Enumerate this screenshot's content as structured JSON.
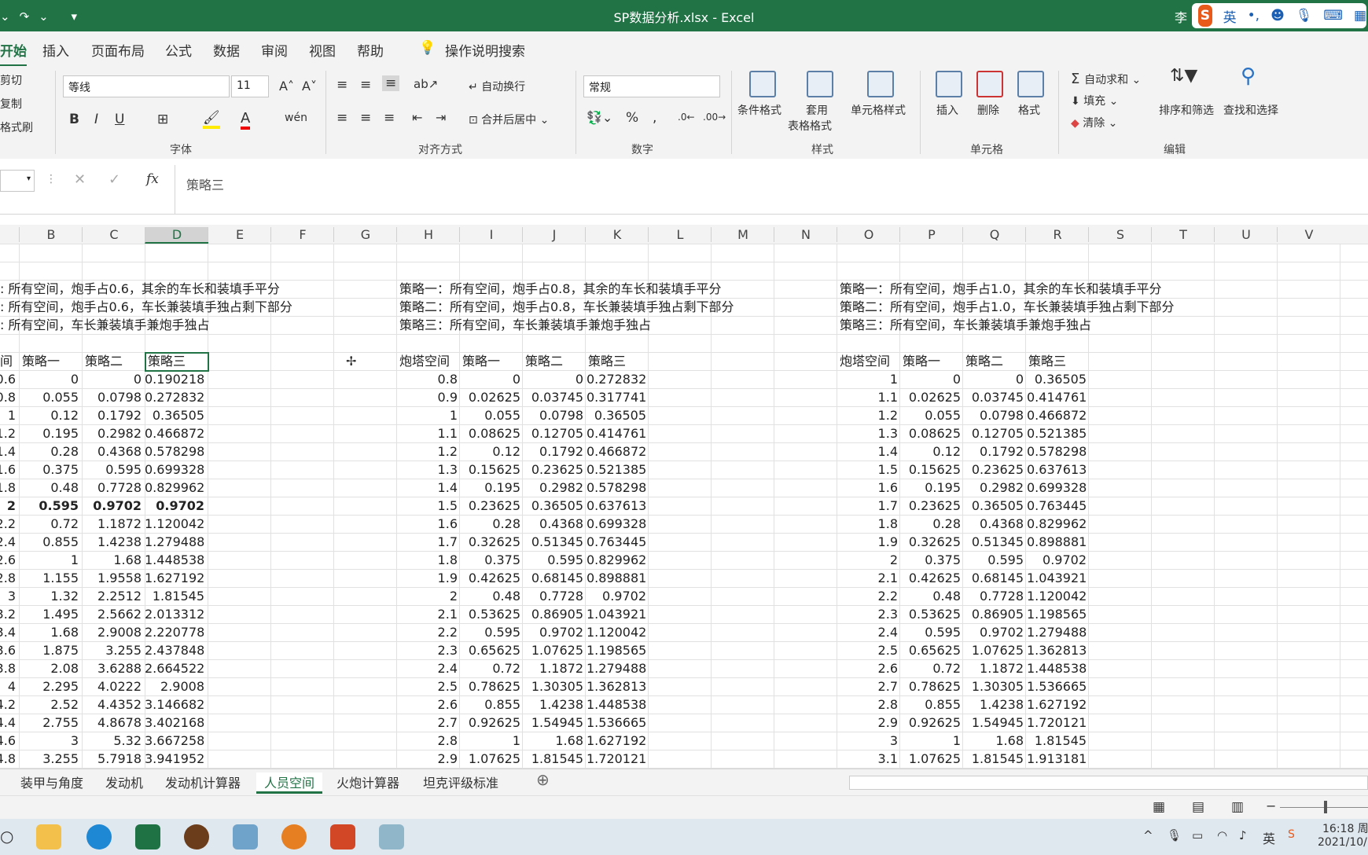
{
  "window": {
    "title": "SP数据分析.xlsx - Excel",
    "user": "李"
  },
  "ime": {
    "logo": "S",
    "mode": "英"
  },
  "menu": [
    "开始",
    "插入",
    "页面布局",
    "公式",
    "数据",
    "审阅",
    "视图",
    "帮助",
    "操作说明搜索"
  ],
  "ribbon": {
    "clipboard": [
      "剪切",
      "复制",
      "格式刷"
    ],
    "font_name": "等线",
    "font_size": "11",
    "font_group": "字体",
    "wrap": "自动换行",
    "merge": "合并后居中",
    "align_group": "对齐方式",
    "number_format": "常规",
    "number_group": "数字",
    "cond_format": "条件格式",
    "table_format_1": "套用",
    "table_format_2": "表格格式",
    "cell_style": "单元格样式",
    "style_group": "样式",
    "insert": "插入",
    "delete": "删除",
    "format": "格式",
    "cells_group": "单元格",
    "autosum": "自动求和",
    "fill": "填充",
    "clear": "清除",
    "sort": "排序和筛选",
    "find": "查找和选择",
    "edit_group": "编辑"
  },
  "formula_bar": {
    "content": "策略三",
    "fx": "fx"
  },
  "columns": [
    "B",
    "C",
    "D",
    "E",
    "F",
    "G",
    "H",
    "I",
    "J",
    "K",
    "L",
    "M",
    "N",
    "O",
    "P",
    "Q",
    "R",
    "S",
    "T",
    "U",
    "V"
  ],
  "blocks": [
    {
      "notes": [
        ":  所有空间，炮手占0.6，其余的车长和装填手平分",
        ":  所有空间，炮手占0.6，车长兼装填手独占剩下部分",
        ":  所有空间，车长兼装填手兼炮手独占"
      ],
      "headers": [
        "间",
        "策略一",
        "策略二",
        "策略三"
      ],
      "rows": [
        [
          "0.6",
          "0",
          "0",
          "0.190218"
        ],
        [
          "0.8",
          "0.055",
          "0.0798",
          "0.272832"
        ],
        [
          "1",
          "0.12",
          "0.1792",
          "0.36505"
        ],
        [
          "1.2",
          "0.195",
          "0.2982",
          "0.466872"
        ],
        [
          "1.4",
          "0.28",
          "0.4368",
          "0.578298"
        ],
        [
          "1.6",
          "0.375",
          "0.595",
          "0.699328"
        ],
        [
          "1.8",
          "0.48",
          "0.7728",
          "0.829962"
        ],
        [
          "2",
          "0.595",
          "0.9702",
          "0.9702"
        ],
        [
          "2.2",
          "0.72",
          "1.1872",
          "1.120042"
        ],
        [
          "2.4",
          "0.855",
          "1.4238",
          "1.279488"
        ],
        [
          "2.6",
          "1",
          "1.68",
          "1.448538"
        ],
        [
          "2.8",
          "1.155",
          "1.9558",
          "1.627192"
        ],
        [
          "3",
          "1.32",
          "2.2512",
          "1.81545"
        ],
        [
          "3.2",
          "1.495",
          "2.5662",
          "2.013312"
        ],
        [
          "3.4",
          "1.68",
          "2.9008",
          "2.220778"
        ],
        [
          "3.6",
          "1.875",
          "3.255",
          "2.437848"
        ],
        [
          "3.8",
          "2.08",
          "3.6288",
          "2.664522"
        ],
        [
          "4",
          "2.295",
          "4.0222",
          "2.9008"
        ],
        [
          "4.2",
          "2.52",
          "4.4352",
          "3.146682"
        ],
        [
          "4.4",
          "2.755",
          "4.8678",
          "3.402168"
        ],
        [
          "4.6",
          "3",
          "5.32",
          "3.667258"
        ],
        [
          "4.8",
          "3.255",
          "5.7918",
          "3.941952"
        ]
      ]
    },
    {
      "notes": [
        "策略一：所有空间，炮手占0.8，其余的车长和装填手平分",
        "策略二：所有空间，炮手占0.8，车长兼装填手独占剩下部分",
        "策略三：所有空间，车长兼装填手兼炮手独占"
      ],
      "headers": [
        "炮塔空间",
        "策略一",
        "策略二",
        "策略三"
      ],
      "rows": [
        [
          "0.8",
          "0",
          "0",
          "0.272832"
        ],
        [
          "0.9",
          "0.02625",
          "0.03745",
          "0.317741"
        ],
        [
          "1",
          "0.055",
          "0.0798",
          "0.36505"
        ],
        [
          "1.1",
          "0.08625",
          "0.12705",
          "0.414761"
        ],
        [
          "1.2",
          "0.12",
          "0.1792",
          "0.466872"
        ],
        [
          "1.3",
          "0.15625",
          "0.23625",
          "0.521385"
        ],
        [
          "1.4",
          "0.195",
          "0.2982",
          "0.578298"
        ],
        [
          "1.5",
          "0.23625",
          "0.36505",
          "0.637613"
        ],
        [
          "1.6",
          "0.28",
          "0.4368",
          "0.699328"
        ],
        [
          "1.7",
          "0.32625",
          "0.51345",
          "0.763445"
        ],
        [
          "1.8",
          "0.375",
          "0.595",
          "0.829962"
        ],
        [
          "1.9",
          "0.42625",
          "0.68145",
          "0.898881"
        ],
        [
          "2",
          "0.48",
          "0.7728",
          "0.9702"
        ],
        [
          "2.1",
          "0.53625",
          "0.86905",
          "1.043921"
        ],
        [
          "2.2",
          "0.595",
          "0.9702",
          "1.120042"
        ],
        [
          "2.3",
          "0.65625",
          "1.07625",
          "1.198565"
        ],
        [
          "2.4",
          "0.72",
          "1.1872",
          "1.279488"
        ],
        [
          "2.5",
          "0.78625",
          "1.30305",
          "1.362813"
        ],
        [
          "2.6",
          "0.855",
          "1.4238",
          "1.448538"
        ],
        [
          "2.7",
          "0.92625",
          "1.54945",
          "1.536665"
        ],
        [
          "2.8",
          "1",
          "1.68",
          "1.627192"
        ],
        [
          "2.9",
          "1.07625",
          "1.81545",
          "1.720121"
        ]
      ]
    },
    {
      "notes": [
        "策略一：所有空间，炮手占1.0，其余的车长和装填手平分",
        "策略二：所有空间，炮手占1.0，车长兼装填手独占剩下部分",
        "策略三：所有空间，车长兼装填手兼炮手独占"
      ],
      "headers": [
        "炮塔空间",
        "策略一",
        "策略二",
        "策略三"
      ],
      "rows": [
        [
          "1",
          "0",
          "0",
          "0.36505"
        ],
        [
          "1.1",
          "0.02625",
          "0.03745",
          "0.414761"
        ],
        [
          "1.2",
          "0.055",
          "0.0798",
          "0.466872"
        ],
        [
          "1.3",
          "0.08625",
          "0.12705",
          "0.521385"
        ],
        [
          "1.4",
          "0.12",
          "0.1792",
          "0.578298"
        ],
        [
          "1.5",
          "0.15625",
          "0.23625",
          "0.637613"
        ],
        [
          "1.6",
          "0.195",
          "0.2982",
          "0.699328"
        ],
        [
          "1.7",
          "0.23625",
          "0.36505",
          "0.763445"
        ],
        [
          "1.8",
          "0.28",
          "0.4368",
          "0.829962"
        ],
        [
          "1.9",
          "0.32625",
          "0.51345",
          "0.898881"
        ],
        [
          "2",
          "0.375",
          "0.595",
          "0.9702"
        ],
        [
          "2.1",
          "0.42625",
          "0.68145",
          "1.043921"
        ],
        [
          "2.2",
          "0.48",
          "0.7728",
          "1.120042"
        ],
        [
          "2.3",
          "0.53625",
          "0.86905",
          "1.198565"
        ],
        [
          "2.4",
          "0.595",
          "0.9702",
          "1.279488"
        ],
        [
          "2.5",
          "0.65625",
          "1.07625",
          "1.362813"
        ],
        [
          "2.6",
          "0.72",
          "1.1872",
          "1.448538"
        ],
        [
          "2.7",
          "0.78625",
          "1.30305",
          "1.536665"
        ],
        [
          "2.8",
          "0.855",
          "1.4238",
          "1.627192"
        ],
        [
          "2.9",
          "0.92625",
          "1.54945",
          "1.720121"
        ],
        [
          "3",
          "1",
          "1.68",
          "1.81545"
        ],
        [
          "3.1",
          "1.07625",
          "1.81545",
          "1.913181"
        ]
      ]
    }
  ],
  "sheet_tabs": [
    "装甲与角度",
    "发动机",
    "发动机计算器",
    "人员空间",
    "火炮计算器",
    "坦克评级标准"
  ],
  "active_tab": "人员空间",
  "tray": {
    "lang": "英",
    "time": "16:18 周",
    "date": "2021/10/"
  },
  "colors": {
    "accent": "#217346"
  }
}
